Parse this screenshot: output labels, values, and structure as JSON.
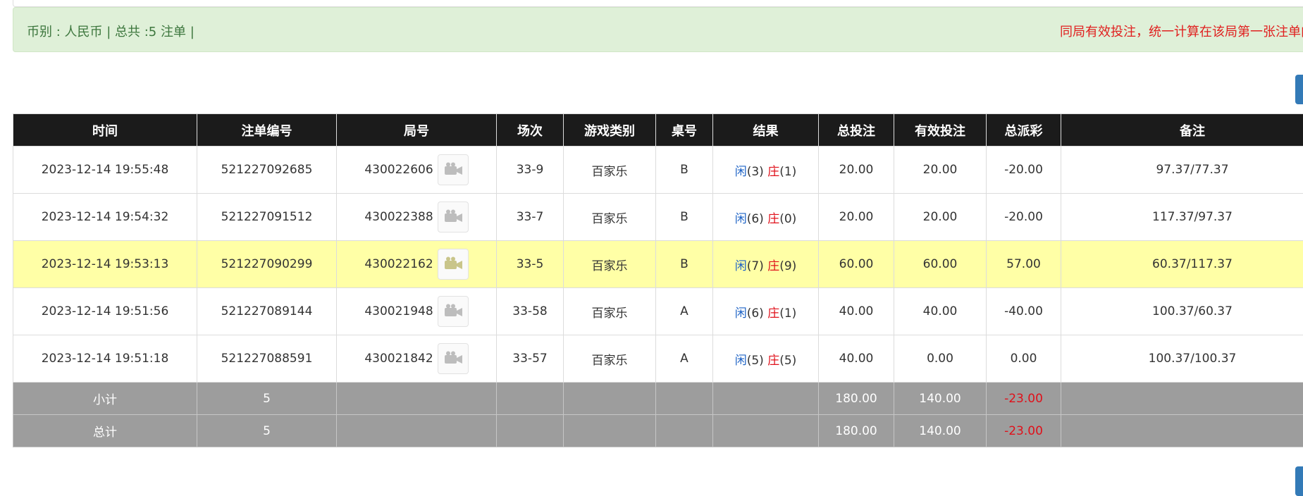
{
  "summary": {
    "left_text": "币别 : 人民币 | 总共 :5 注单 |",
    "right_text": "同局有效投注，统一计算在该局第一张注单内"
  },
  "colors": {
    "accent_blue": "#337ab7",
    "win_blue": "#1e63c6",
    "loss_red": "#e0101a",
    "highlight": "#ffffa6"
  },
  "table": {
    "headers": [
      "时间",
      "注单编号",
      "局号",
      "场次",
      "游戏类别",
      "桌号",
      "结果",
      "总投注",
      "有效投注",
      "总派彩",
      "备注"
    ],
    "rows": [
      {
        "time": "2023-12-14 19:55:48",
        "bet_id": "521227092685",
        "round": "430022606",
        "session": "33-9",
        "game": "百家乐",
        "table": "B",
        "player_label": "闲",
        "player_score": "(3)",
        "banker_label": "庄",
        "banker_score": "(1)",
        "total_bet": "20.00",
        "valid_bet": "20.00",
        "payout": "-20.00",
        "note": "97.37/77.37"
      },
      {
        "time": "2023-12-14 19:54:32",
        "bet_id": "521227091512",
        "round": "430022388",
        "session": "33-7",
        "game": "百家乐",
        "table": "B",
        "player_label": "闲",
        "player_score": "(6)",
        "banker_label": "庄",
        "banker_score": "(0)",
        "total_bet": "20.00",
        "valid_bet": "20.00",
        "payout": "-20.00",
        "note": "117.37/97.37"
      },
      {
        "time": "2023-12-14 19:53:13",
        "bet_id": "521227090299",
        "round": "430022162",
        "session": "33-5",
        "game": "百家乐",
        "table": "B",
        "player_label": "闲",
        "player_score": "(7)",
        "banker_label": "庄",
        "banker_score": "(9)",
        "total_bet": "60.00",
        "valid_bet": "60.00",
        "payout": "57.00",
        "note": "60.37/117.37"
      },
      {
        "time": "2023-12-14 19:51:56",
        "bet_id": "521227089144",
        "round": "430021948",
        "session": "33-58",
        "game": "百家乐",
        "table": "A",
        "player_label": "闲",
        "player_score": "(6)",
        "banker_label": "庄",
        "banker_score": "(1)",
        "total_bet": "40.00",
        "valid_bet": "40.00",
        "payout": "-40.00",
        "note": "100.37/60.37"
      },
      {
        "time": "2023-12-14 19:51:18",
        "bet_id": "521227088591",
        "round": "430021842",
        "session": "33-57",
        "game": "百家乐",
        "table": "A",
        "player_label": "闲",
        "player_score": "(5)",
        "banker_label": "庄",
        "banker_score": "(5)",
        "total_bet": "40.00",
        "valid_bet": "0.00",
        "payout": "0.00",
        "note": "100.37/100.37"
      }
    ],
    "subtotal": {
      "label": "小计",
      "count": "5",
      "total_bet": "180.00",
      "valid_bet": "140.00",
      "payout": "-23.00"
    },
    "total": {
      "label": "总计",
      "count": "5",
      "total_bet": "180.00",
      "valid_bet": "140.00",
      "payout": "-23.00"
    }
  }
}
